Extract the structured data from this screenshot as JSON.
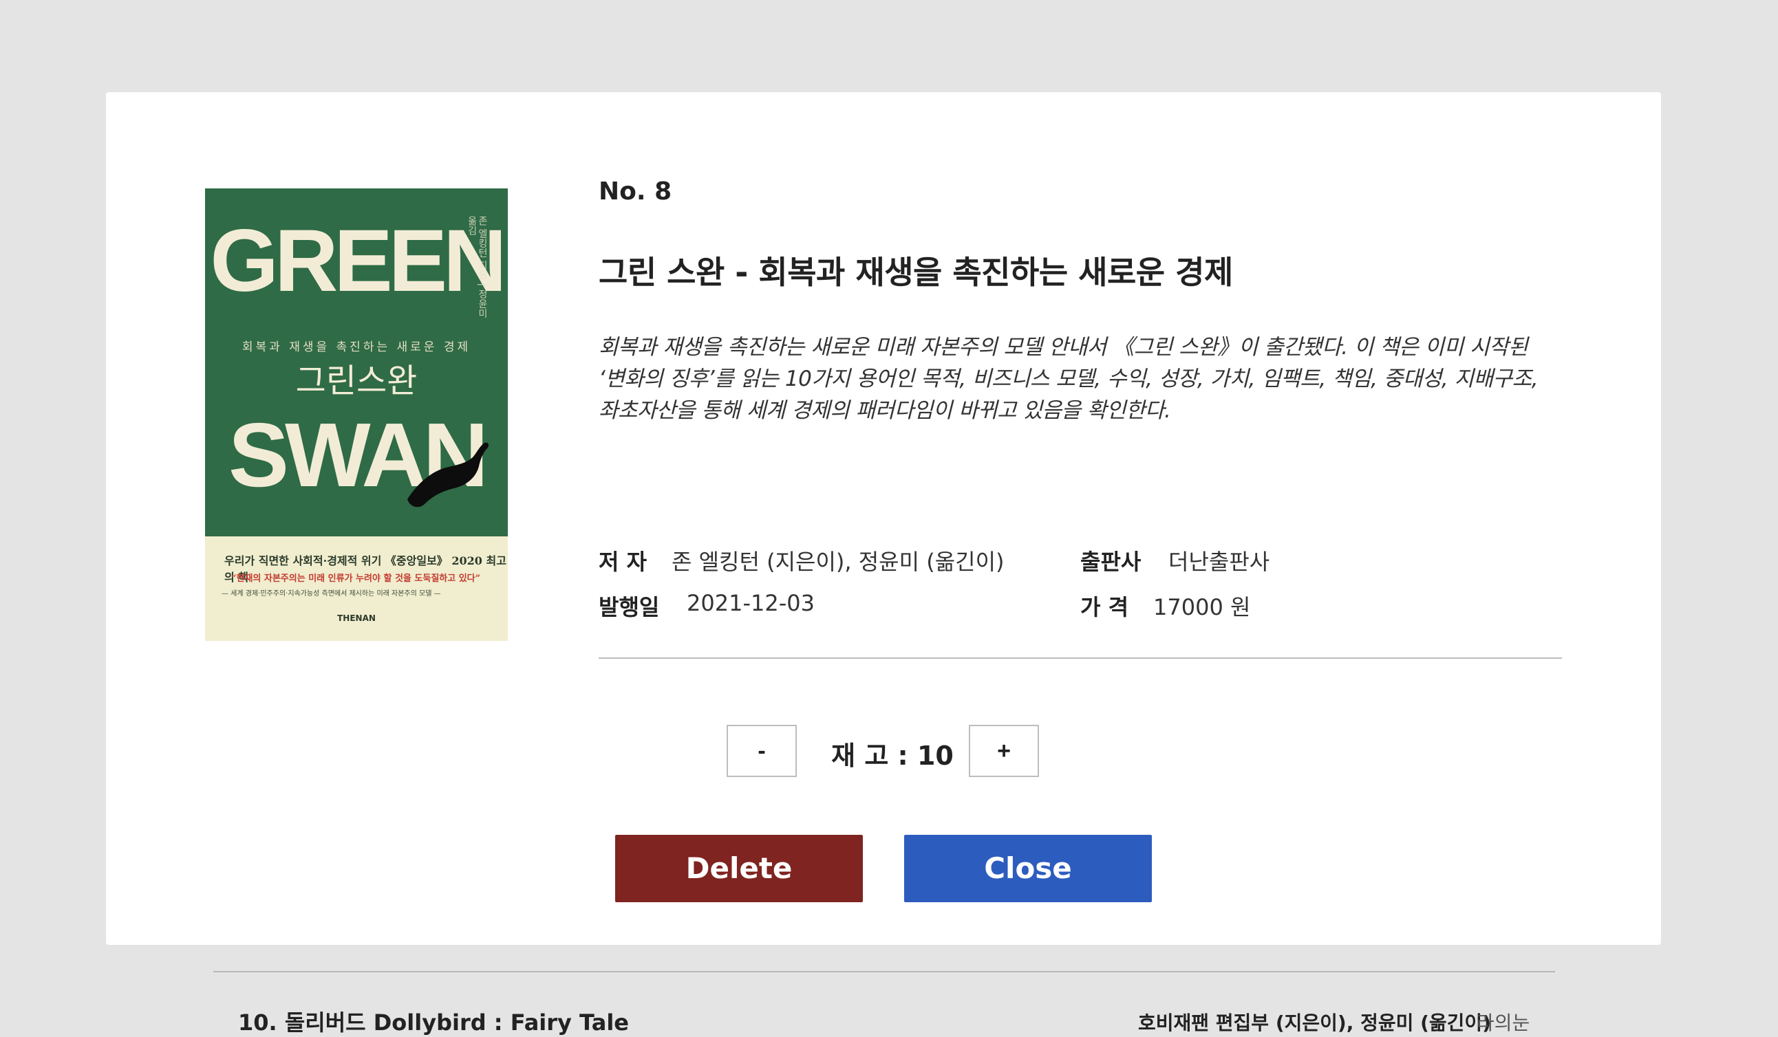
{
  "modal": {
    "book_number": "No. 8",
    "title": "그린 스완 - 회복과 재생을 촉진하는 새로운 경제",
    "description_lines": [
      "회복과 재생을 촉진하는 새로운 미래 자본주의 모델 안내서 《그린 스완》이 출간됐다. 이 책은 이미 시작된",
      "‘변화의 징후’를 읽는 10가지 용어인 목적, 비즈니스 모델, 수익, 성장, 가치, 임팩트, 책임, 중대성, 지배구조,",
      "좌초자산을 통해 세계 경제의 패러다임이 바뀌고 있음을 확인한다."
    ],
    "author_label": "저 자",
    "author_value": "존 엘킹턴 (지은이), 정윤미 (옮긴이)",
    "publisher_label": "출판사",
    "publisher_value": "더난출판사",
    "date_label": "발행일",
    "date_value": "2021-12-03",
    "price_label": "가 격",
    "price_value": "17000 원",
    "stock": {
      "decrement_label": "-",
      "label": "재 고 : 10",
      "increment_label": "+"
    },
    "delete_label": "Delete",
    "close_label": "Close",
    "cover": {
      "word_top": "GREEN",
      "word_bottom": "SWAN",
      "subtitle": "회복과 재생을 촉진하는 새로운 경제",
      "korean_title": "그린스완",
      "spine_text": "존 엘킹턴 지음 | 정윤미 옮김",
      "tagline": "우리가 직면한 사회적·경제적 위기 《중앙일보》 2020 최고의 책",
      "quote": "“현재의 자본주의는 미래 인류가 누려야 할 것을 도둑질하고 있다”",
      "footnote": "— 세계 경제·민주주의·지속가능성 측면에서 제시하는 미래 자본주의 모델 —",
      "publisher_logo": "THENAN",
      "colors": {
        "green": "#2f6b46",
        "cream": "#f1edcf",
        "red": "#c23a2e"
      }
    }
  },
  "background_list": {
    "row_title": "10.   돌리버드 Dollybird : Fairy Tale",
    "row_author": "호비재팬 편집부 (지은이), 정윤미 (옮긴이)",
    "row_publisher": "라의눈"
  },
  "colors": {
    "page_background": "#e4e4e4",
    "delete_button": "#7f2420",
    "close_button": "#2d5cbf"
  }
}
